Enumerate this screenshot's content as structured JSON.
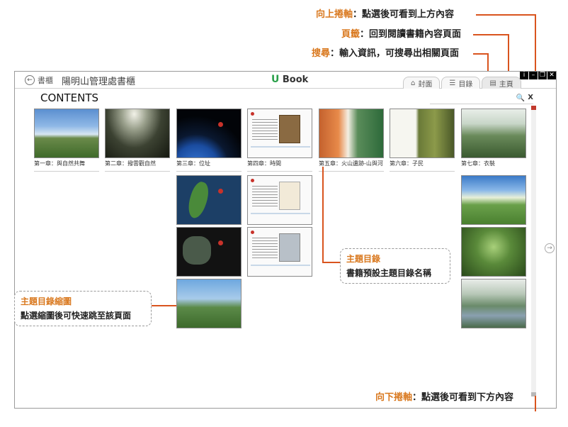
{
  "callouts": {
    "scroll_up": {
      "label": "向上捲軸",
      "desc": "：點選後可看到上方內容"
    },
    "bookmark": {
      "label": "頁籤",
      "desc": "：回到閱讀書籍內容頁面"
    },
    "search": {
      "label": "搜尋",
      "desc": "：輸入資訊，可搜尋出相關頁面"
    },
    "toc": {
      "label": "主題目錄",
      "desc": "書籍預設主題目錄名稱"
    },
    "thumb": {
      "label": "主題目錄縮圖",
      "desc": "點選縮圖後可快速跳至該頁面"
    },
    "scroll_down": {
      "label": "向下捲軸",
      "desc": "：點選後可看到下方內容"
    }
  },
  "header": {
    "back_label": "書櫃",
    "app_title": "陽明山管理處書櫃",
    "brand_u": "U",
    "brand_name": " Book",
    "window_controls": [
      "i",
      "–",
      "❐",
      "✕"
    ]
  },
  "tabs": [
    {
      "label": "封面",
      "icon": "home-icon",
      "glyph": "⌂"
    },
    {
      "label": "目錄",
      "icon": "list-icon",
      "glyph": "☰"
    },
    {
      "label": "主頁",
      "icon": "bookmark-icon",
      "glyph": "▤"
    }
  ],
  "contents_title": "CONTENTS",
  "search": {
    "icon": "search-icon",
    "glyph": "🔍",
    "close": "X",
    "placeholder": ""
  },
  "chapters": [
    {
      "caption": "第一章：與自然共舞",
      "theme": "mtn"
    },
    {
      "caption": "第二章：撥雲觀自然",
      "theme": "rays"
    },
    {
      "caption": "第三章：位址",
      "theme": "earth"
    },
    {
      "caption": "第四章：時間",
      "theme": "doc"
    },
    {
      "caption": "第五章：火山遺跡-山與河",
      "theme": "volcano"
    },
    {
      "caption": "第六章：子民",
      "theme": "green"
    },
    {
      "caption": "第七章：衣裝",
      "theme": "forest"
    }
  ],
  "nav": {
    "next_glyph": "→"
  }
}
